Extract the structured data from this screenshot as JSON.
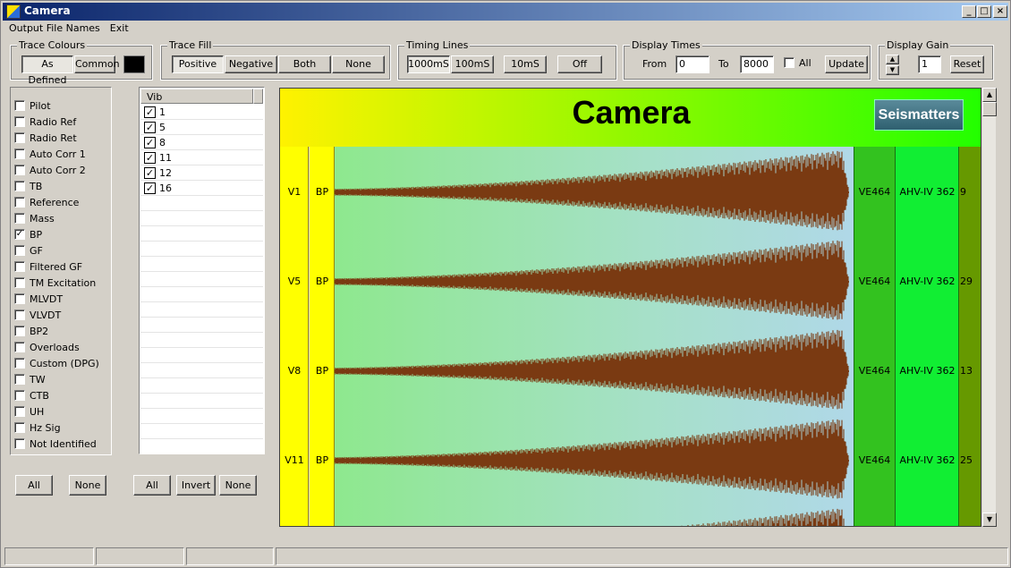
{
  "window": {
    "title": "Camera"
  },
  "menu": [
    "Output File Names",
    "Exit"
  ],
  "trace_colours": {
    "legend": "Trace Colours",
    "as_defined": "As Defined",
    "common": "Common",
    "swatch_color": "#000000"
  },
  "trace_fill": {
    "legend": "Trace Fill",
    "options": [
      "Positive",
      "Negative",
      "Both",
      "None"
    ],
    "selected": "Positive"
  },
  "timing_lines": {
    "legend": "Timing Lines",
    "options": [
      "1000mS",
      "100mS",
      "10mS",
      "Off"
    ],
    "selected": "1000mS"
  },
  "display_times": {
    "legend": "Display Times",
    "from_label": "From",
    "from_value": "0",
    "to_label": "To",
    "to_value": "8000",
    "all_label": "All",
    "all_checked": false,
    "update": "Update"
  },
  "display_gain": {
    "legend": "Display Gain",
    "value": "1",
    "reset": "Reset"
  },
  "signals": [
    {
      "label": "Pilot",
      "checked": false
    },
    {
      "label": "Radio Ref",
      "checked": false
    },
    {
      "label": "Radio Ret",
      "checked": false
    },
    {
      "label": "Auto Corr 1",
      "checked": false
    },
    {
      "label": "Auto Corr 2",
      "checked": false
    },
    {
      "label": "TB",
      "checked": false
    },
    {
      "label": "Reference",
      "checked": false
    },
    {
      "label": "Mass",
      "checked": false
    },
    {
      "label": "BP",
      "checked": true
    },
    {
      "label": "GF",
      "checked": false
    },
    {
      "label": "Filtered GF",
      "checked": false
    },
    {
      "label": "TM Excitation",
      "checked": false
    },
    {
      "label": "MLVDT",
      "checked": false
    },
    {
      "label": "VLVDT",
      "checked": false
    },
    {
      "label": "BP2",
      "checked": false
    },
    {
      "label": "Overloads",
      "checked": false
    },
    {
      "label": "Custom (DPG)",
      "checked": false
    },
    {
      "label": "TW",
      "checked": false
    },
    {
      "label": "CTB",
      "checked": false
    },
    {
      "label": "UH",
      "checked": false
    },
    {
      "label": "Hz Sig",
      "checked": false
    },
    {
      "label": "Not Identified",
      "checked": false
    }
  ],
  "signals_buttons": {
    "all": "All",
    "none": "None"
  },
  "vib_grid": {
    "header": "Vib",
    "rows": [
      {
        "label": "1",
        "checked": true
      },
      {
        "label": "5",
        "checked": true
      },
      {
        "label": "8",
        "checked": true
      },
      {
        "label": "11",
        "checked": true
      },
      {
        "label": "12",
        "checked": true
      },
      {
        "label": "16",
        "checked": true
      }
    ]
  },
  "vib_buttons": {
    "all": "All",
    "invert": "Invert",
    "none": "None"
  },
  "camera": {
    "title": "Camera",
    "logo": "Seismatters",
    "traces": [
      {
        "vib": "V1",
        "signal": "BP",
        "unit": "VE464",
        "model": "AHV-IV 362",
        "num": "9"
      },
      {
        "vib": "V5",
        "signal": "BP",
        "unit": "VE464",
        "model": "AHV-IV 362",
        "num": "29"
      },
      {
        "vib": "V8",
        "signal": "BP",
        "unit": "VE464",
        "model": "AHV-IV 362",
        "num": "13"
      },
      {
        "vib": "V11",
        "signal": "BP",
        "unit": "VE464",
        "model": "AHV-IV 362",
        "num": "25"
      }
    ],
    "colors": {
      "waveform": "#7a3a12",
      "header_left": "#fff200",
      "header_right": "#22ff00",
      "vib_col": "#ffff00",
      "unit_col": "#33c21f",
      "model_col": "#11ee33",
      "num_col": "#669900"
    }
  }
}
